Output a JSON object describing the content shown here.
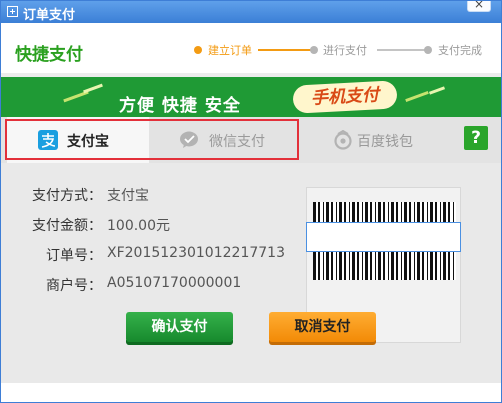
{
  "window": {
    "title": "订单支付",
    "close_label": "×"
  },
  "header": {
    "brand": "快捷支付",
    "steps": [
      {
        "label": "建立订单",
        "active": true
      },
      {
        "label": "进行支付",
        "active": false
      },
      {
        "label": "支付完成",
        "active": false
      }
    ]
  },
  "banner": {
    "slogan": "方便 快捷 安全",
    "badge": "手机支付"
  },
  "tabs": [
    {
      "label": "支付宝",
      "icon": "alipay-icon",
      "active": true
    },
    {
      "label": "微信支付",
      "icon": "wechat-icon",
      "active": false
    },
    {
      "label": "百度钱包",
      "icon": "baidu-wallet-icon",
      "active": false
    }
  ],
  "help": {
    "label": "?"
  },
  "details": [
    {
      "label": "支付方式：",
      "value": "支付宝"
    },
    {
      "label": "支付金额：",
      "value": "100.00元"
    },
    {
      "label": "订单号：",
      "value": "XF201512301012217713"
    },
    {
      "label": "商户号：",
      "value": "A05107170000001"
    }
  ],
  "barcode": {
    "input_value": "",
    "input_placeholder": ""
  },
  "buttons": {
    "confirm": "确认支付",
    "cancel": "取消支付"
  },
  "colors": {
    "accent_green": "#2aa01f",
    "step_orange": "#f39b13",
    "highlight_red": "#e3303a"
  }
}
